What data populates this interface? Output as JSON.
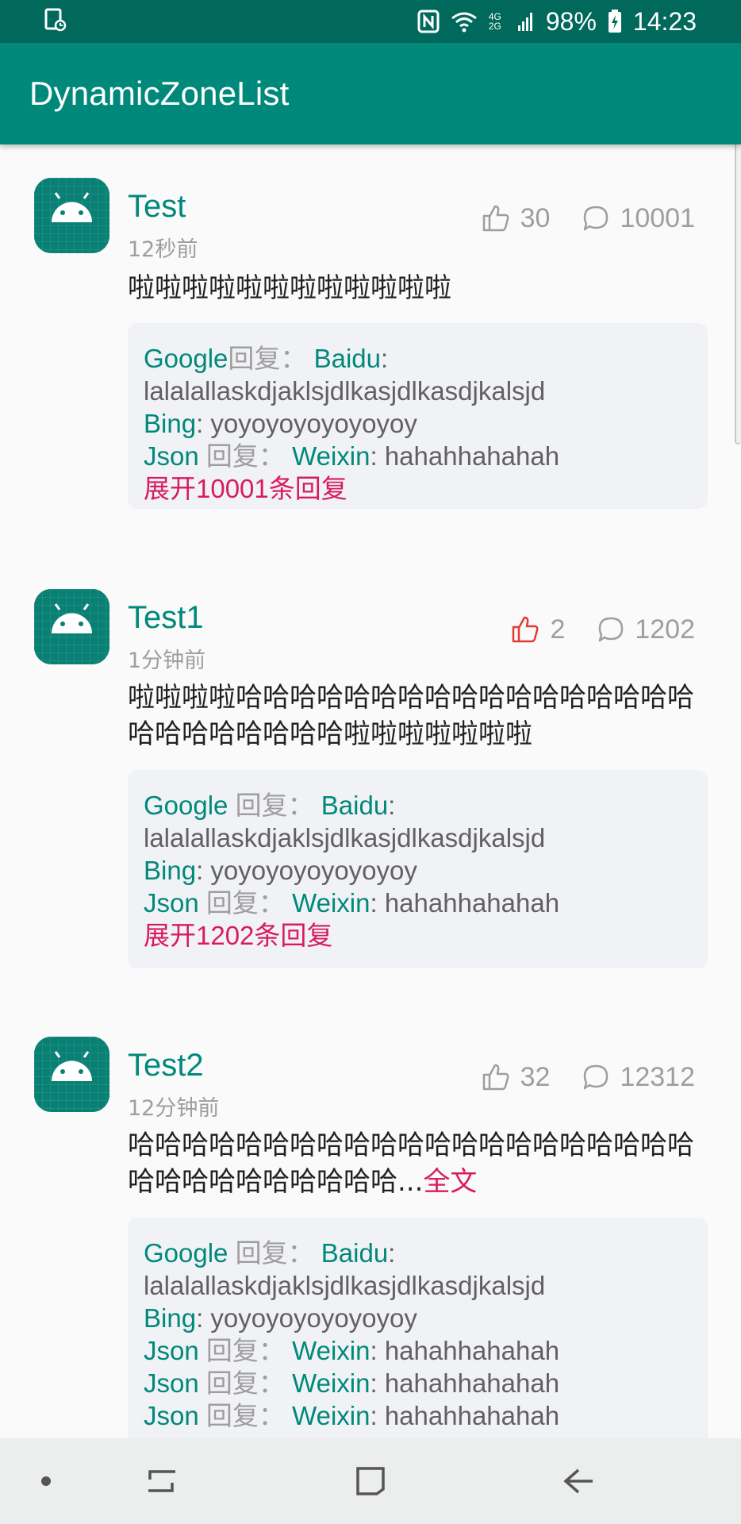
{
  "status_bar": {
    "battery": "98%",
    "time": "14:23",
    "network_label": "4G 2G",
    "icons": [
      "screen-record-icon",
      "nfc-icon",
      "wifi-icon",
      "signal-icon",
      "battery-charging-icon"
    ]
  },
  "app_bar": {
    "title": "DynamicZoneList"
  },
  "colors": {
    "primary": "#00897b",
    "primary_dark": "#00695c",
    "accent": "#d81b60",
    "liked": "#e53935"
  },
  "posts": [
    {
      "name": "Test",
      "time": "12秒前",
      "likes": "30",
      "liked": false,
      "comments": "10001",
      "text": "啦啦啦啦啦啦啦啦啦啦啦啦",
      "more": "",
      "replies": [
        {
          "from": "Google",
          "reply_word": "回复：",
          "to": "Baidu",
          "text": "lalalallaskdjaklsjdlkasjdlkasdjkalsjd"
        },
        {
          "from": "Bing",
          "reply_word": "",
          "to": "",
          "text": "yoyoyoyoyoyoyoy"
        },
        {
          "from": "Json",
          "reply_word": "回复：",
          "to": "Weixin",
          "text": "hahahhahahah"
        }
      ],
      "expand": "展开10001条回复"
    },
    {
      "name": "Test1",
      "time": "1分钟前",
      "likes": "2",
      "liked": true,
      "comments": "1202",
      "text": "啦啦啦啦哈哈哈哈哈哈哈哈哈哈哈哈哈哈哈哈哈哈哈哈哈哈哈哈哈啦啦啦啦啦啦啦",
      "more": "",
      "replies": [
        {
          "from": "Google",
          "reply_word": "回复：",
          "to": "Baidu",
          "text": "lalalallaskdjaklsjdlkasjdlkasdjkalsjd"
        },
        {
          "from": "Bing",
          "reply_word": "",
          "to": "",
          "text": "yoyoyoyoyoyoyoy"
        },
        {
          "from": "Json",
          "reply_word": "回复：",
          "to": "Weixin",
          "text": "hahahhahahah"
        }
      ],
      "expand": "展开1202条回复"
    },
    {
      "name": "Test2",
      "time": "12分钟前",
      "likes": "32",
      "liked": false,
      "comments": "12312",
      "text": "哈哈哈哈哈哈哈哈哈哈哈哈哈哈哈哈哈哈哈哈哈哈哈哈哈哈哈哈哈哈哈...",
      "more": "全文",
      "replies": [
        {
          "from": "Google",
          "reply_word": "回复：",
          "to": "Baidu",
          "text": "lalalallaskdjaklsjdlkasjdlkasdjkalsjd"
        },
        {
          "from": "Bing",
          "reply_word": "",
          "to": "",
          "text": "yoyoyoyoyoyoyoy"
        },
        {
          "from": "Json",
          "reply_word": "回复：",
          "to": "Weixin",
          "text": "hahahhahahah"
        },
        {
          "from": "Json",
          "reply_word": "回复：",
          "to": "Weixin",
          "text": "hahahhahahah"
        },
        {
          "from": "Json",
          "reply_word": "回复：",
          "to": "Weixin",
          "text": "hahahhahahah"
        }
      ],
      "expand": ""
    }
  ],
  "nav_bar": {
    "icons": [
      "dot-icon",
      "recents-icon",
      "home-icon",
      "back-icon"
    ]
  }
}
